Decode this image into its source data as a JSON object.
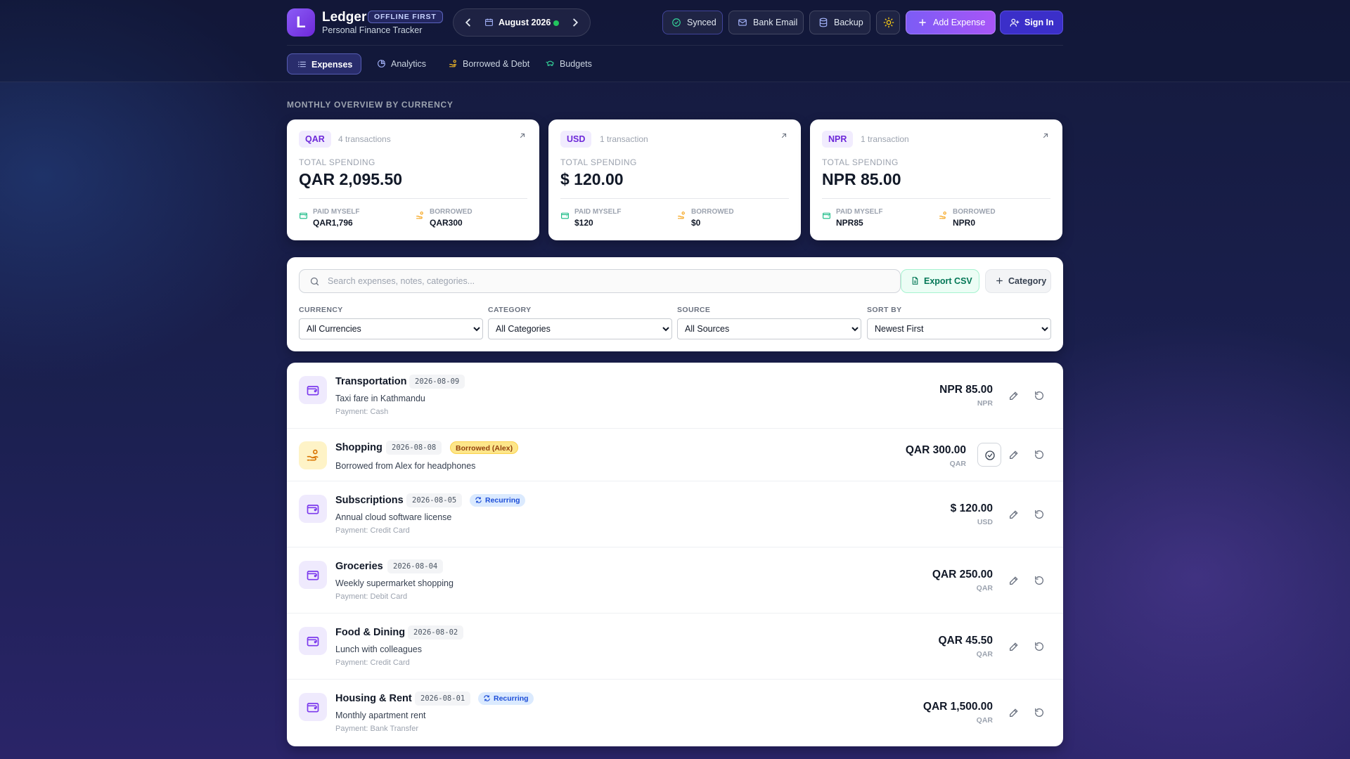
{
  "brand": {
    "logo_letter": "L",
    "title": "Ledger",
    "badge": "OFFLINE FIRST",
    "subtitle": "Personal Finance Tracker"
  },
  "month_nav": {
    "label": "August 2026",
    "prev_icon": "chevron-left-icon",
    "next_icon": "chevron-right-icon"
  },
  "toolbar": {
    "synced": "Synced",
    "bank_email": "Bank Email",
    "backup": "Backup",
    "theme_icon": "sun-icon",
    "add_expense": "Add Expense",
    "sign_in": "Sign In"
  },
  "tabs": [
    {
      "label": "Expenses",
      "icon": "list-icon",
      "active": true
    },
    {
      "label": "Analytics",
      "icon": "pie-chart-icon",
      "active": false
    },
    {
      "label": "Borrowed & Debt",
      "icon": "hand-coins-icon",
      "active": false
    },
    {
      "label": "Budgets",
      "icon": "piggy-bank-icon",
      "active": false
    }
  ],
  "overview": {
    "title": "MONTHLY OVERVIEW BY CURRENCY",
    "cards": [
      {
        "currency": "QAR",
        "count": "4 transactions",
        "total_label": "TOTAL SPENDING",
        "total": "QAR 2,095.50",
        "paid_label": "PAID MYSELF",
        "paid": "QAR1,796",
        "borrowed_label": "BORROWED",
        "borrowed": "QAR300"
      },
      {
        "currency": "USD",
        "count": "1 transaction",
        "total_label": "TOTAL SPENDING",
        "total": "$ 120.00",
        "paid_label": "PAID MYSELF",
        "paid": "$120",
        "borrowed_label": "BORROWED",
        "borrowed": "$0"
      },
      {
        "currency": "NPR",
        "count": "1 transaction",
        "total_label": "TOTAL SPENDING",
        "total": "NPR 85.00",
        "paid_label": "PAID MYSELF",
        "paid": "NPR85",
        "borrowed_label": "BORROWED",
        "borrowed": "NPR0"
      }
    ]
  },
  "filters": {
    "search_placeholder": "Search expenses, notes, categories...",
    "export_csv": "Export CSV",
    "category_button": "Category",
    "currency_label": "CURRENCY",
    "currency_value": "All Currencies",
    "category_label": "CATEGORY",
    "category_value": "All Categories",
    "source_label": "SOURCE",
    "source_value": "All Sources",
    "sort_label": "SORT BY",
    "sort_value": "Newest First"
  },
  "expenses": [
    {
      "category": "Transportation",
      "date": "2026-08-09",
      "description": "Taxi fare in Kathmandu",
      "payment": "Payment: Cash",
      "amount": "NPR 85.00",
      "currency": "NPR"
    },
    {
      "category": "Shopping",
      "date": "2026-08-08",
      "badge": "Borrowed (Alex)",
      "description": "Borrowed from Alex for headphones",
      "amount": "QAR 300.00",
      "currency": "QAR"
    },
    {
      "category": "Subscriptions",
      "date": "2026-08-05",
      "badge": "Recurring",
      "description": "Annual cloud software license",
      "payment": "Payment: Credit Card",
      "amount": "$ 120.00",
      "currency": "USD"
    },
    {
      "category": "Groceries",
      "date": "2026-08-04",
      "description": "Weekly supermarket shopping",
      "payment": "Payment: Debit Card",
      "amount": "QAR 250.00",
      "currency": "QAR"
    },
    {
      "category": "Food & Dining",
      "date": "2026-08-02",
      "description": "Lunch with colleagues",
      "payment": "Payment: Credit Card",
      "amount": "QAR 45.50",
      "currency": "QAR"
    },
    {
      "category": "Housing & Rent",
      "date": "2026-08-01",
      "badge": "Recurring",
      "description": "Monthly apartment rent",
      "payment": "Payment: Bank Transfer",
      "amount": "QAR 1,500.00",
      "currency": "QAR"
    }
  ],
  "colors": {
    "accent": "#7c5cf5",
    "borrowed": "#d97706",
    "recurring": "#1d4ed8",
    "synced_dot": "#22c55e"
  }
}
